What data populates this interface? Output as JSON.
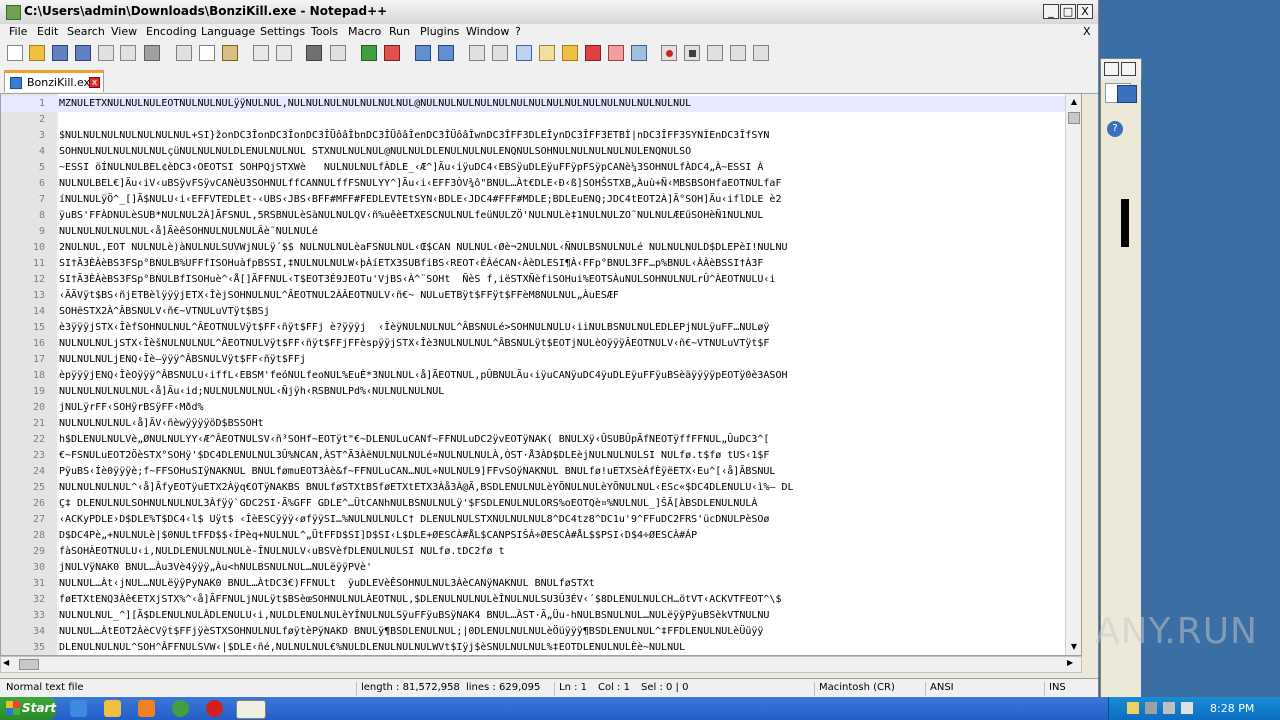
{
  "window": {
    "title": "C:\\Users\\admin\\Downloads\\BonziKill.exe - Notepad++",
    "minimize": "_",
    "maximize": "□",
    "close": "X"
  },
  "menu": {
    "items": [
      "File",
      "Edit",
      "Search",
      "View",
      "Encoding",
      "Language",
      "Settings",
      "Tools",
      "Macro",
      "Run",
      "Plugins",
      "Window",
      "?"
    ],
    "close_doc": "X"
  },
  "tab": {
    "label": "BonziKill.exe",
    "close": "x"
  },
  "editor": {
    "lines": [
      {
        "n": "1",
        "text": "MZNULETXNULNULNULEOTNULNULNULÿÿNULNUL,NULNULNULNULNULNULNUL@NULNULNULNULNULNULNULNULNULNULNULNULNULNULNUL"
      },
      {
        "n": "2",
        "text": ""
      },
      {
        "n": "3",
        "text": "$NULNULNULNULNULNULNUL+SI}žonDC3ÎonDC3ÎonDC3ÎÜôâÎbnDC3ÎÜôâÎenDC3ÎÜôâÎwnDC3ÎFF3DLEÎynDC3ÎFF3ETBÌ|nDC3ÎFF3SYNÌEnDC3ÎfSYN"
      },
      {
        "n": "4",
        "text": "SOHNULNULNULNULNULçüNULNULNULDLENULNULNUL STXNULNULNUL@NULNULDLENULNULNULENQNULSOHNULNULNULNULNULENQNULSO"
      },
      {
        "n": "5",
        "text": "~ESSI öÍNULNULBEL¢èDC3‹OEOTSI SOHPQjSTXWè   NULNULNULfÀDLE_‹Æ^]Ãu‹iÿuDC4‹EBSÿuDLEÿuFFÿpFSÿpCANè¼3SOHNULfÀDC4„À~ESSI À"
      },
      {
        "n": "6",
        "text": "NULNULBEL€]Ãu‹iV‹uBSÿvFSÿvCANèU3SOHNULffCANNULffFSNULYY^]Ãu‹i‹EFF3ÒV¾ô\"BNUL…Àt€DLE‹Ð‹ß]SOHŠSTXB„Àuù+Ñ‹MBSBSOHfaEOTNULfaF"
      },
      {
        "n": "7",
        "text": "íNULNULÿÖ^_[]Ã$NULU‹i‹EFFVTEDLEt-‹UBS‹JBS‹BFF#MFF#FEDLEVTEtSYN‹BDLE‹JDC4#FFF#MDLE;BDLEuENQ;JDC4tEOT2À]Ã°SOH]Ãu‹iflDLE è2"
      },
      {
        "n": "8",
        "text": "ÿuBS'FFÀDNULèSUB*NULNUL2À]ÃFSNUL,5RSBNULèSàNULNULQV‹ñ%uêèETXESCNULNULfeüNULZÖ'NULNULè‡1NULNULZO˜NULNULÆEüSOHèÑ1NULNUL"
      },
      {
        "n": "9",
        "text": "NULNULNULNULNUL‹å]ÃèêSOHNULNULNULÂè˜NULNULé"
      },
      {
        "n": "10",
        "text": "2NULNUL,EOT NULNULè)àNULNULSUVWjNULÿ´$$ NULNULNULèaFSNULNUL‹Œ$CAN NULNUL‹Øè¬2NULNUL‹ÑNULBSNULNULé NULNULNULD$DLEPèI!NULNU"
      },
      {
        "n": "11",
        "text": "SI†Ã3ÈÀèBS3FSp°BNULB%UFFfISOHuàfpBSSI,‡NULNULNULW‹þÀíETX3SUBfiBS‹REOT‹ÈÀéCAN‹ÀèDLESI¶À‹FFp°BNUL3FF…p%BNUL‹ÀÀèBSSI†À3F"
      },
      {
        "n": "12",
        "text": "SI†Ã3ÈÀèBS3FSp°BNULBfISOHuè^‹Å[]ÃFFNUL‹T$EOT3É9JEOTu'VjBS‹À^¨SOHt  ÑèS f‚iëSTXÑèfiSOHui%EOTSÀuNULSOHNULNULrÛ^ÀEOTNULU‹i"
      },
      {
        "n": "13",
        "text": "‹ÃÄVÿt$BS‹ñjETBèlÿÿÿjETX‹ÎèjSOHNULNUL^ÂEOTNUL2ÀÂEOTNULV‹ñ€~ NULuETBÿt$FFÿt$FFèM8NULNUL„ÀuESÆF"
      },
      {
        "n": "14",
        "text": "SOHëSTX2À^ÂBSNULV‹ñ€~VTNULuVTÿt$BSj"
      },
      {
        "n": "15",
        "text": "è3ÿÿÿjSTX‹ÎèfSOHNULNUL^ÂEOTNULVÿt$FF‹ñÿt$FFj è?ÿÿÿj  ‹ÎèÿNULNULNUL^ÂBSNULé>SOHNULNULU‹iiNULBSNULNULEDLEPjNULÿuFF…NULøÿ"
      },
      {
        "n": "16",
        "text": "NULNULNULjSTX‹ÎèšNULNULNUL^ÂEOTNULVÿt$FF‹ñÿt$FFjFFèspÿÿjSTX‹Îè3NULNULNUL^ÂBSNULÿt$EOTjNULèOÿÿÿÂEOTNULV‹ñ€~VTNULuVTÿt$F"
      },
      {
        "n": "17",
        "text": "NULNULNULjENQ‹Îè—ÿÿÿ^ÂBSNULVÿt$FF‹ñÿt$FFj"
      },
      {
        "n": "18",
        "text": "èpÿÿÿjENQ‹ÎèOÿÿÿ^ÂBSNULU‹iffL‹EBSM'feóNULfeoNUL%EuÈ*3NULNUL‹å]ÃEOTNUL,pÛBNULÃu‹iÿuCANÿuDC4ÿuDLEÿuFFÿuBSèäÿÿÿÿpEOTÿ0è3ASOH"
      },
      {
        "n": "19",
        "text": "NULNULNULNULNUL‹å]Ãu‹id;NULNULNULNUL‹Ñjÿh‹RSBNULPd%‹NULNULNULNUL"
      },
      {
        "n": "20",
        "text": "jNULÿrFF‹SOHÿrBSÿFF‹Mðd%"
      },
      {
        "n": "21",
        "text": "NULNULNULNUL‹å]ÃV‹ñèwÿÿÿÿöD$BSSOHt"
      },
      {
        "n": "22",
        "text": "h$DLENULNULVè„ØNULNULYY‹Æ^ÂEOTNULSV‹ñ³SOHf~EOTÿt\"€~DLENULuCANf~FFNULuDC2ÿvEOTÿNAK( BNULXÿ‹ÛSUBÛpÃfNEOTÿffFFNUL„ÛuDC3^["
      },
      {
        "n": "23",
        "text": "€~FSNULuEOT2ÖèSTX°SOHÿ'$DC4DLENULNUL3Û%NCAN,ÀST^Ã3ÀëNULNULNULé¤NULNULNULÀ,ÒST·Å3ÀD$DLEèjNULNULNULSI NULfø.t$fø tUS‹1$F"
      },
      {
        "n": "24",
        "text": "PÿuBS‹Íè0ÿÿÿè;f~FFSOHuSIÿNAKNUL BNULfømuEOT3Àè&f~FFNULuCAN…NUL÷NULNUL9]FFvSOÿNAKNUL BNULfø!uETXSèÁfÈÿëETX‹Eu^[‹å]ÃBSNUL"
      },
      {
        "n": "25",
        "text": "NULNULNULNUL^‹å]ÃfyEOTÿuETX2Àÿq€OTÿNAKBS BNULføSTXtBSføETXtETX3Àå3À@Ã‚BSDLENULNULèYÕNULNULèYÕNULNUL‹ESc«$DC4DLENULU‹ì%— DL"
      },
      {
        "n": "26",
        "text": "Ç‡ DLENULNULSOHNULNULNUL3Àfÿÿ`GDC2SI·Ã%GFF GDLE^…ÜtCANhNULBSNULNULÿ'$FSDLENULNULORS%oEOTQè¤%NULNUL_]ŠÃ[ÀBSDLENULNULÀ"
      },
      {
        "n": "27",
        "text": "‹ACKyPDLE›D$DLE%T$DC4‹l$ Uÿt$ ‹ÎèESCÿÿÿ‹øfÿÿSI…%NULNULNULC† DLENULNULSTXNULNULNUL8^DC4tz8^DC1u'9^FFuDC2FRS'ücDNULPèSOø"
      },
      {
        "n": "28",
        "text": "D$DC4Pè„+NULNULè|$0NULtFFD$$‹ÍPèq+NULNUL^„ÜtFFD$SI]D$SI‹L$DLE+ØESCÀ#ÅL$CANPSIŠÁ÷ØESCÀ#ÅL$$PSI‹D$4÷ØESCÀ#ÁP"
      },
      {
        "n": "29",
        "text": "fàSOHÀEOTNULU‹i,NULDLENULNULNULè-ÎNULNULV‹uBSVèfDLENULNULSI NULfø.tDC2fø t"
      },
      {
        "n": "30",
        "text": "jNULVÿNAK0 BNUL…Àu3Vè4ÿÿÿ„Àu<hNULBSNULNUL…NULëÿÿPVè'"
      },
      {
        "n": "31",
        "text": "NULNUL…Àt‹jNUL…NULëÿÿPyNAK0 BNUL…ÀtDC3€)FFNULt  ÿuDLEVèÊSOHNULNUL3ÀèCANÿNAKNUL BNULføSTXt"
      },
      {
        "n": "32",
        "text": "føETXtENQ3Àê€ETXjSTX%^‹å]ÃFFNULjNULÿt$BSèœSOHNULNULÀEOTNUL,$DLENULNULNULèÎNULNULSU3Û3ÉV‹´$8DLENULNULCH…ötVT‹ACKVTFEOT^\\$"
      },
      {
        "n": "33",
        "text": "NULNULNUL_^][Ã$DLENULNULÀDLENULU‹i,NULDLENULNULèYÎNULNULSÿuFFÿuBSÿNAK4 BNUL…ÀST·Ã„Üu-hNULBSNULNUL…NULëÿÿPÿuBSèkVTNULNU"
      },
      {
        "n": "34",
        "text": "NULNUL…ÀtEOT2ÀèCVÿt$FFjÿèSTXSOHNULNULføÿtèPÿNAKD BNULÿ¶BSDLENULNUL;|0DLENULNULNULèÖüÿÿÿ¶BSDLENULNUL^‡FFDLENULNULèÜüÿÿ"
      },
      {
        "n": "35",
        "text": "DLENULNULNUL^SOH^ÂFFNULSVW‹|$DLE‹ñé,NULNULNUL€%NULDLENULNULNULWVt$Iÿj$èSNULNULNUL%‡EOTDLENULNULÈè~NULNUL"
      }
    ]
  },
  "status": {
    "type": "Normal text file",
    "length": "length : 81,572,958",
    "lines": "lines : 629,095",
    "ln": "Ln : 1",
    "col": "Col : 1",
    "sel": "Sel : 0 | 0",
    "eol": "Macintosh (CR)",
    "encoding": "ANSI",
    "mode": "INS"
  },
  "taskbar": {
    "start": "Start",
    "clock": "8:28 PM"
  },
  "watermark": "ANY.RUN"
}
